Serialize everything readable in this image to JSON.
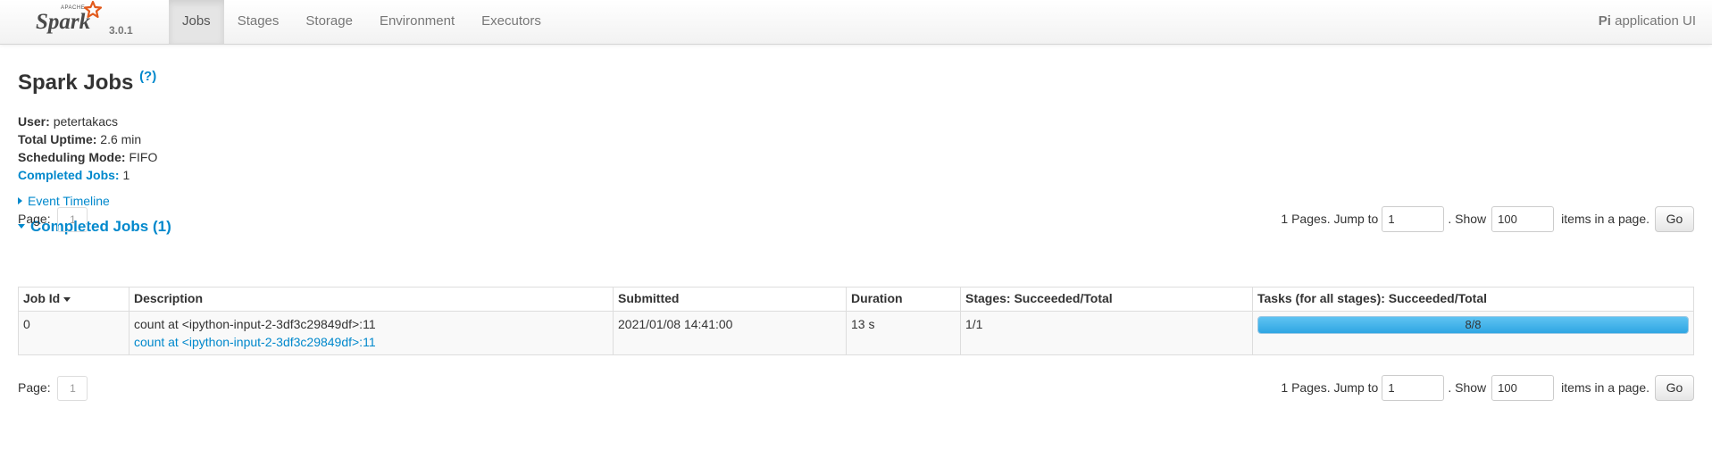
{
  "navbar": {
    "brand_word": "Spark",
    "brand_super": "APACHE",
    "version": "3.0.1",
    "tabs": [
      {
        "label": "Jobs",
        "active": true
      },
      {
        "label": "Stages",
        "active": false
      },
      {
        "label": "Storage",
        "active": false
      },
      {
        "label": "Environment",
        "active": false
      },
      {
        "label": "Executors",
        "active": false
      }
    ],
    "app_name_bold": "Pi",
    "app_name_rest": " application UI",
    "logo_color": "#e25a1c"
  },
  "page": {
    "title": "Spark Jobs",
    "help_mark": "(?)"
  },
  "summary": {
    "user_label": "User:",
    "user_value": "petertakacs",
    "uptime_label": "Total Uptime:",
    "uptime_value": "2.6 min",
    "mode_label": "Scheduling Mode:",
    "mode_value": "FIFO",
    "completed_label": "Completed Jobs:",
    "completed_value": "1"
  },
  "event_timeline": "Event Timeline",
  "completed_section": "Completed Jobs (1)",
  "pagination": {
    "page_label": "Page:",
    "current_page": "1",
    "pages_text": "1 Pages. Jump to",
    "jump_value": "1",
    "show_text": ". Show",
    "show_value": "100",
    "items_text": "items in a page.",
    "go_label": "Go"
  },
  "table": {
    "headers": [
      "Job Id",
      "Description",
      "Submitted",
      "Duration",
      "Stages: Succeeded/Total",
      "Tasks (for all stages): Succeeded/Total"
    ],
    "rows": [
      {
        "job_id": "0",
        "description": "count at <ipython-input-2-3df3c29849df>:11",
        "description_link": "count at <ipython-input-2-3df3c29849df>:11",
        "submitted": "2021/01/08 14:41:00",
        "duration": "13 s",
        "stages": "1/1",
        "tasks_label": "8/8",
        "tasks_progress": 1.0
      }
    ]
  },
  "colors": {
    "link": "#0088cc",
    "progress_fill": "#3eb0ea"
  }
}
